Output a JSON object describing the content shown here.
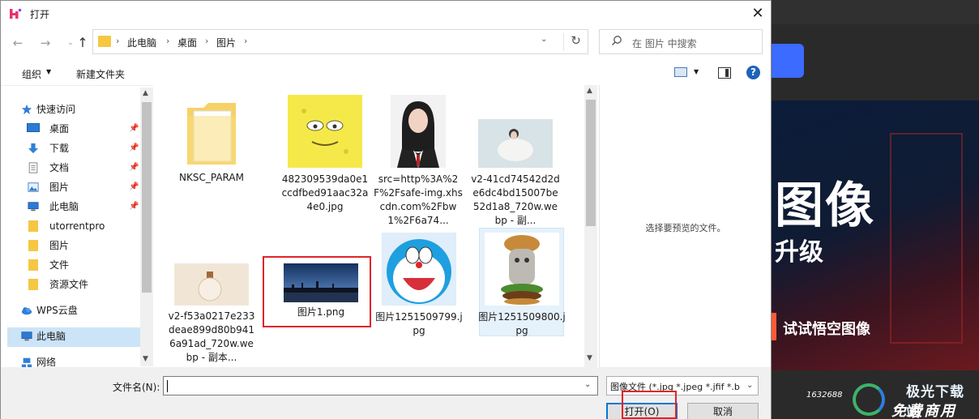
{
  "dialog": {
    "title": "打开",
    "close_glyph": "✕"
  },
  "nav": {
    "back_glyph": "←",
    "forward_glyph": "→",
    "recent_glyph": "⌄",
    "up_glyph": "↑",
    "breadcrumbs": [
      "此电脑",
      "桌面",
      "图片"
    ],
    "breadcrumb_sep": "›",
    "dropdown_glyph": "⌄",
    "refresh_glyph": "↻"
  },
  "search": {
    "placeholder": "在 图片 中搜索",
    "icon": "search-icon"
  },
  "toolbar": {
    "organize": "组织",
    "organize_caret": "▼",
    "new_folder": "新建文件夹",
    "view_caret": "▼",
    "help": "?"
  },
  "sidebar": {
    "items": [
      {
        "label": "快速访问",
        "icon": "star-icon",
        "pinned": false
      },
      {
        "label": "桌面",
        "icon": "desktop-icon",
        "pinned": true
      },
      {
        "label": "下载",
        "icon": "download-icon",
        "pinned": true
      },
      {
        "label": "文档",
        "icon": "document-icon",
        "pinned": true
      },
      {
        "label": "图片",
        "icon": "pictures-icon",
        "pinned": true
      },
      {
        "label": "此电脑",
        "icon": "computer-icon",
        "pinned": true
      },
      {
        "label": "utorrentpro",
        "icon": "folder-icon",
        "pinned": false
      },
      {
        "label": "图片",
        "icon": "folder-icon",
        "pinned": false
      },
      {
        "label": "文件",
        "icon": "folder-icon",
        "pinned": false
      },
      {
        "label": "资源文件",
        "icon": "folder-icon",
        "pinned": false
      },
      {
        "label": "WPS云盘",
        "icon": "cloud-icon",
        "pinned": false
      },
      {
        "label": "此电脑",
        "icon": "computer-icon",
        "pinned": false
      },
      {
        "label": "网络",
        "icon": "network-icon",
        "pinned": false
      }
    ],
    "pin_glyph": "📌",
    "scroll_up": "▲",
    "scroll_down": "▼"
  },
  "files": [
    {
      "name": "NKSC_PARAM",
      "type": "folder"
    },
    {
      "name": "482309539da0e1ccdfbed91aac32a4e0.jpg",
      "type": "image"
    },
    {
      "name": "src=http%3A%2F%2Fsafe-img.xhscdn.com%2Fbw1%2F6a74...",
      "type": "image"
    },
    {
      "name": "v2-41cd74542d2de6dc4bd15007be52d1a8_720w.webp - 副...",
      "type": "image"
    },
    {
      "name": "v2-f53a0217e233deae899d80b9416a91ad_720w.webp - 副本...",
      "type": "image"
    },
    {
      "name": "图片1.png",
      "type": "image"
    },
    {
      "name": "图片1251509799.jpg",
      "type": "image"
    },
    {
      "name": "图片1251509800.jpg",
      "type": "image"
    }
  ],
  "file_scroll": {
    "up": "▲",
    "down": "▼"
  },
  "preview": {
    "text": "选择要预览的文件。"
  },
  "bottom": {
    "filename_label": "文件名(N):",
    "filename_value": "",
    "filetype_value": "图像文件 (*.jpg *.jpeg *.jfif *.b",
    "caret": "⌄",
    "open": "打开(O)",
    "cancel": "取消"
  },
  "background": {
    "title": "图像",
    "subtitle": "升级",
    "cta": "试试悟空图像",
    "count": "1632688",
    "brand_line1": "极光下载站",
    "brand_line2": "免费商用"
  },
  "colors": {
    "accent": "#0078d7",
    "highlight": "#e0242a",
    "selection": "#cce4f7",
    "folder": "#f5c743"
  }
}
